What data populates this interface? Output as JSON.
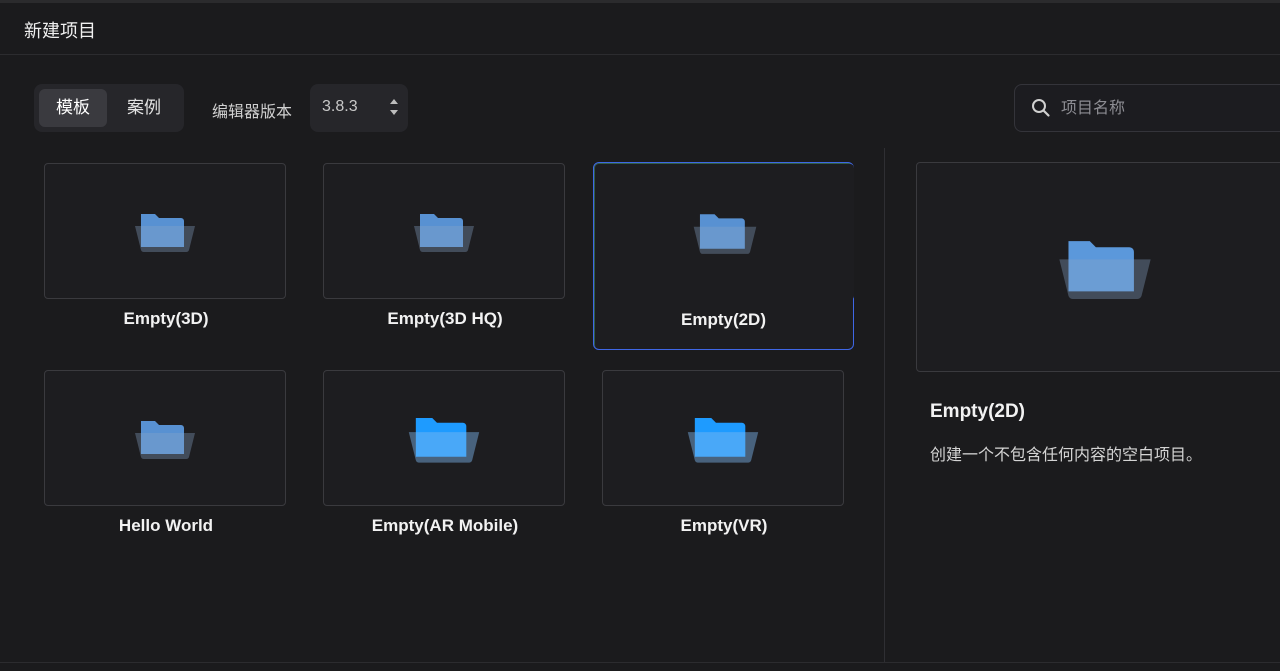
{
  "window": {
    "title": "新建项目"
  },
  "tabs": [
    {
      "label": "模板",
      "active": true
    },
    {
      "label": "案例",
      "active": false
    }
  ],
  "editor_version": {
    "label": "编辑器版本",
    "value": "3.8.3"
  },
  "search": {
    "placeholder": "项目名称",
    "value": "",
    "icon": "search-icon"
  },
  "templates": [
    {
      "label": "Empty(3D)",
      "icon": "folder-icon",
      "style": "muted",
      "selected": false
    },
    {
      "label": "Empty(3D HQ)",
      "icon": "folder-icon",
      "style": "muted",
      "selected": false
    },
    {
      "label": "Empty(2D)",
      "icon": "folder-icon",
      "style": "muted",
      "selected": true
    },
    {
      "label": "Hello World",
      "icon": "folder-icon",
      "style": "muted",
      "selected": false
    },
    {
      "label": "Empty(AR Mobile)",
      "icon": "folder-icon",
      "style": "bright",
      "selected": false
    },
    {
      "label": "Empty(VR)",
      "icon": "folder-icon",
      "style": "bright",
      "selected": false
    }
  ],
  "preview": {
    "title": "Empty(2D)",
    "description": "创建一个不包含任何内容的空白项目。",
    "icon": "folder-icon"
  },
  "colors": {
    "background": "#1b1b1d",
    "selected_border": "#3f67e6",
    "folder_muted": "#5f9fe6",
    "folder_bright": "#1e9bff"
  }
}
